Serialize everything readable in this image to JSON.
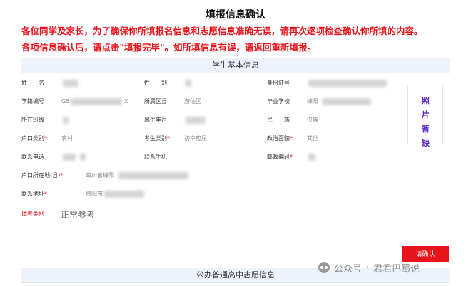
{
  "page": {
    "title": "填报信息确认",
    "notice_1": "各位同学及家长，为了确保你所填报名信息和志愿信息准确无误，请再次逐项检查确认你所填的内容。",
    "notice_2": "各项信息确认后，请点击\"填报完毕\"。如所填信息有误，请返回重新填报。"
  },
  "basic_info": {
    "section_title": "学生基本信息",
    "fields": {
      "name_label": "姓　　名",
      "gender_label": "性　　别",
      "id_label": "身份证号",
      "student_no_label": "学籍编号",
      "student_no_prefix": "G5",
      "student_no_suffix": "X",
      "district_label": "所属区县",
      "district_value": "游仙区",
      "school_label": "毕业学校",
      "school_value": "绵阳",
      "class_label": "所在班级",
      "birth_label": "出生年月",
      "ethnicity_label": "民　　族",
      "ethnicity_value": "汉族",
      "hukou_type_label": "户口类别",
      "hukou_type_value": "农村",
      "candidate_type_label": "考生类别",
      "candidate_type_value": "初中应届",
      "political_label": "政治面貌",
      "political_value": "其他",
      "phone_label": "联系电话",
      "mobile_label": "联系手机",
      "zip_label": "邮政编码",
      "hukou_addr_label": "户口所在地(县)",
      "hukou_addr_value": "四川省绵阳",
      "address_label": "联系地址",
      "address_value": "绵阳市",
      "exam_label": "体考类别",
      "exam_value": "正常参考"
    },
    "required_mark": "*"
  },
  "photo": {
    "text": "照片暂缺"
  },
  "actions": {
    "confirm_label": "请确认"
  },
  "volunteer": {
    "section_title": "公办普通高中志愿信息"
  },
  "watermark": {
    "platform": "公众号",
    "separator": "·",
    "account": "君君巴蜀说"
  },
  "colors": {
    "notice_red": "#e8141b",
    "section_bg": "#eef3fb",
    "photo_text": "#5b2bc4"
  }
}
